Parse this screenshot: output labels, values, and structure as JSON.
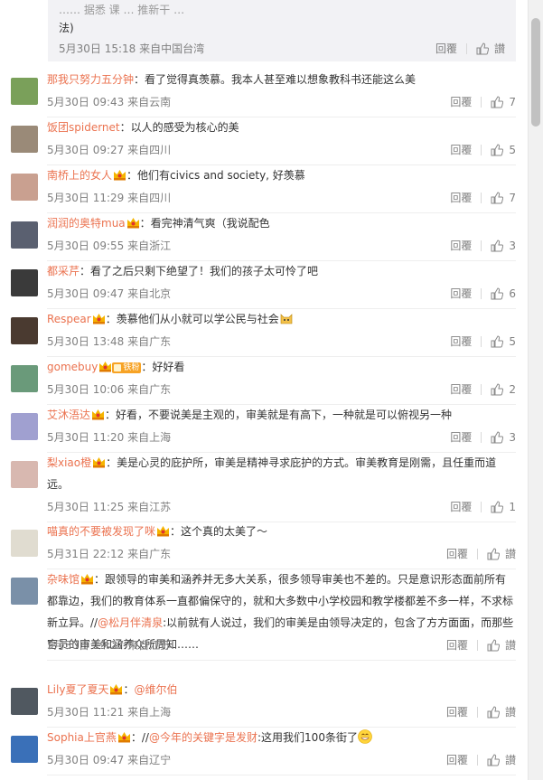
{
  "quote": {
    "cut_text": "…… 据悉 课 … 推新干 …",
    "text": "法)",
    "meta": "5月30日 15:18 来自中国台湾",
    "reply": "回覆",
    "like": "讃"
  },
  "comments": [
    {
      "name": "那我只努力五分钟",
      "sep": "：",
      "text": "看了觉得真羡慕。我本人甚至难以想象教科书还能这么美",
      "meta": "5月30日 09:43 来自云南",
      "reply": "回覆",
      "likes": "7",
      "avatar_color": "#7aa05a"
    },
    {
      "name": "饭团spidernet",
      "sep": "：",
      "text": "以人的感受为核心的美",
      "meta": "5月30日 09:27 来自四川",
      "reply": "回覆",
      "likes": "5",
      "avatar_color": "#9a8a78"
    },
    {
      "name": "南桥上的女人",
      "sep": "：",
      "text": "他们有civics and society, 好羡慕",
      "meta": "5月30日 11:29 来自四川",
      "reply": "回覆",
      "likes": "7",
      "avatar_color": "#c9a090"
    },
    {
      "name": "润润的奥特mua",
      "sep": "：",
      "text": "看完神清气爽（我说配色",
      "meta": "5月30日 09:55 来自浙江",
      "reply": "回覆",
      "likes": "3",
      "avatar_color": "#5a6070"
    },
    {
      "name": "都采芹",
      "sep": "：",
      "text": "看了之后只剩下绝望了！我们的孩子太可怜了吧",
      "meta": "5月30日 09:47 来自北京",
      "reply": "回覆",
      "likes": "6",
      "avatar_color": "#3a3a3a"
    },
    {
      "name": "Respear",
      "sep": "：",
      "text": "羡慕他们从小就可以学公民与社会",
      "meta": "5月30日 13:48 来自广东",
      "reply": "回覆",
      "likes": "5",
      "avatar_color": "#4a3a30"
    },
    {
      "name": "gomebuy",
      "fan": "铁粉",
      "sep": "：",
      "text": "好好看",
      "meta": "5月30日 10:06 来自广东",
      "reply": "回覆",
      "likes": "2",
      "avatar_color": "#6a9a7a"
    },
    {
      "name": "艾沐浯达",
      "sep": "：",
      "text": "好看，不要说美是主观的，审美就是有高下，一种就是可以俯视另一种",
      "meta": "5月30日 11:20 来自上海",
      "reply": "回覆",
      "likes": "3",
      "avatar_color": "#a0a0d0"
    },
    {
      "name": "梨xiao橙",
      "sep": "：",
      "text": "美是心灵的庇护所，审美是精神寻求庇护的方式。审美教育是刚需，且任重而道远。",
      "meta": "5月30日 11:25 来自江苏",
      "reply": "回覆",
      "likes": "1",
      "avatar_color": "#d8b8b0"
    },
    {
      "name": "喵真的不要被发现了咪",
      "sep": "：",
      "text": "这个真的太美了～",
      "meta": "5月31日 22:12 来自广东",
      "reply": "回覆",
      "likes": "讃",
      "avatar_color": "#e0dcd0"
    },
    {
      "name": "杂味馆",
      "sep": "：",
      "text": "跟领导的审美和涵养并无多大关系，很多领导审美也不差的。只是意识形态面前所有都靠边，我们的教育体系一直都偏保守的，就和大多数中小学校园和教学楼都差不多一样，不求标新立异。//",
      "mention": "@松月伴清泉",
      "text2": ":以前就有人说过，我们的审美是由领导决定的，包含了方方面面，而那些官员的审美和涵养众所周知……",
      "meta": "5月30日 19:27 来自江苏",
      "reply": "回覆",
      "likes": "讃",
      "avatar_color": "#7a90a8"
    },
    {
      "name": "Lily夏了夏天",
      "sep": "：",
      "text": "",
      "mention": "@维尔伯",
      "meta": "5月30日 11:21 来自上海",
      "reply": "回覆",
      "likes": "讃",
      "avatar_color": "#505860"
    },
    {
      "name": "Sophia上官燕",
      "sep": "：",
      "text": "//",
      "mention": "@今年的关键字是发财",
      "text2": ":这用我们100条街了",
      "meta": "5月30日 09:47 来自辽宁",
      "reply": "回覆",
      "likes": "讃",
      "avatar_color": "#3a70b8"
    }
  ]
}
